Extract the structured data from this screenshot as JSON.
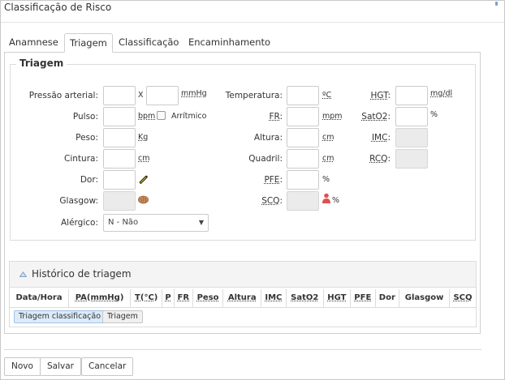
{
  "window": {
    "title": "Classificação de Risco"
  },
  "tabs": [
    "Anamnese",
    "Triagem",
    "Classificação",
    "Encaminhamento"
  ],
  "active_tab": "Triagem",
  "triagem": {
    "legend": "Triagem",
    "pressao": {
      "label": "Pressão arterial:",
      "sep": "X",
      "unit": "mmHg"
    },
    "pulso": {
      "label": "Pulso:",
      "unit": "bpm",
      "check_label": "Arrítmico"
    },
    "peso": {
      "label": "Peso:",
      "unit": "Kg"
    },
    "cintura": {
      "label": "Cintura:",
      "unit": "cm"
    },
    "dor": {
      "label": "Dor:"
    },
    "glasgow": {
      "label": "Glasgow:"
    },
    "alergico": {
      "label": "Alérgico:",
      "value": "N - Não"
    },
    "temperatura": {
      "label": "Temperatura:",
      "unit": "ºC"
    },
    "fr": {
      "label": "FR",
      "colon": ":",
      "unit": "mpm"
    },
    "altura": {
      "label": "Altura:",
      "unit": "cm"
    },
    "quadril": {
      "label": "Quadril:",
      "unit": "cm"
    },
    "pfe": {
      "label": "PFE",
      "colon": ":",
      "unit": "%"
    },
    "scq": {
      "label": "SCQ",
      "colon": ":",
      "unit": "%"
    },
    "hgt": {
      "label": "HGT",
      "colon": ":",
      "unit": "mg/dl"
    },
    "sato2": {
      "label": "SatO2",
      "colon": ":",
      "unit": "%"
    },
    "imc": {
      "label": "IMC",
      "colon": ":"
    },
    "rcq": {
      "label": "RCQ",
      "colon": ":"
    }
  },
  "historico": {
    "title": "Histórico de triagem",
    "columns": [
      "Data/Hora",
      "PA(mmHg)",
      "T(°C)",
      "P",
      "FR",
      "Peso",
      "Altura",
      "IMC",
      "SatO2",
      "HGT",
      "PFE",
      "Dor",
      "Glasgow",
      "SCQ"
    ],
    "buttons": [
      "Triagem classificação",
      "Triagem"
    ]
  },
  "footer": {
    "buttons": [
      "Novo",
      "Salvar",
      "Cancelar"
    ]
  },
  "icons": {
    "dor": "pencil-ruler-icon",
    "glasgow": "brain-icon",
    "scq": "burn-body-icon",
    "historico": "collapse-triangle-icon"
  },
  "colors": {
    "accent_blue": "#dcebfa",
    "icon_brain": "#c98a5a",
    "icon_scq": "#d9534f",
    "icon_dor": "#e0c000"
  }
}
